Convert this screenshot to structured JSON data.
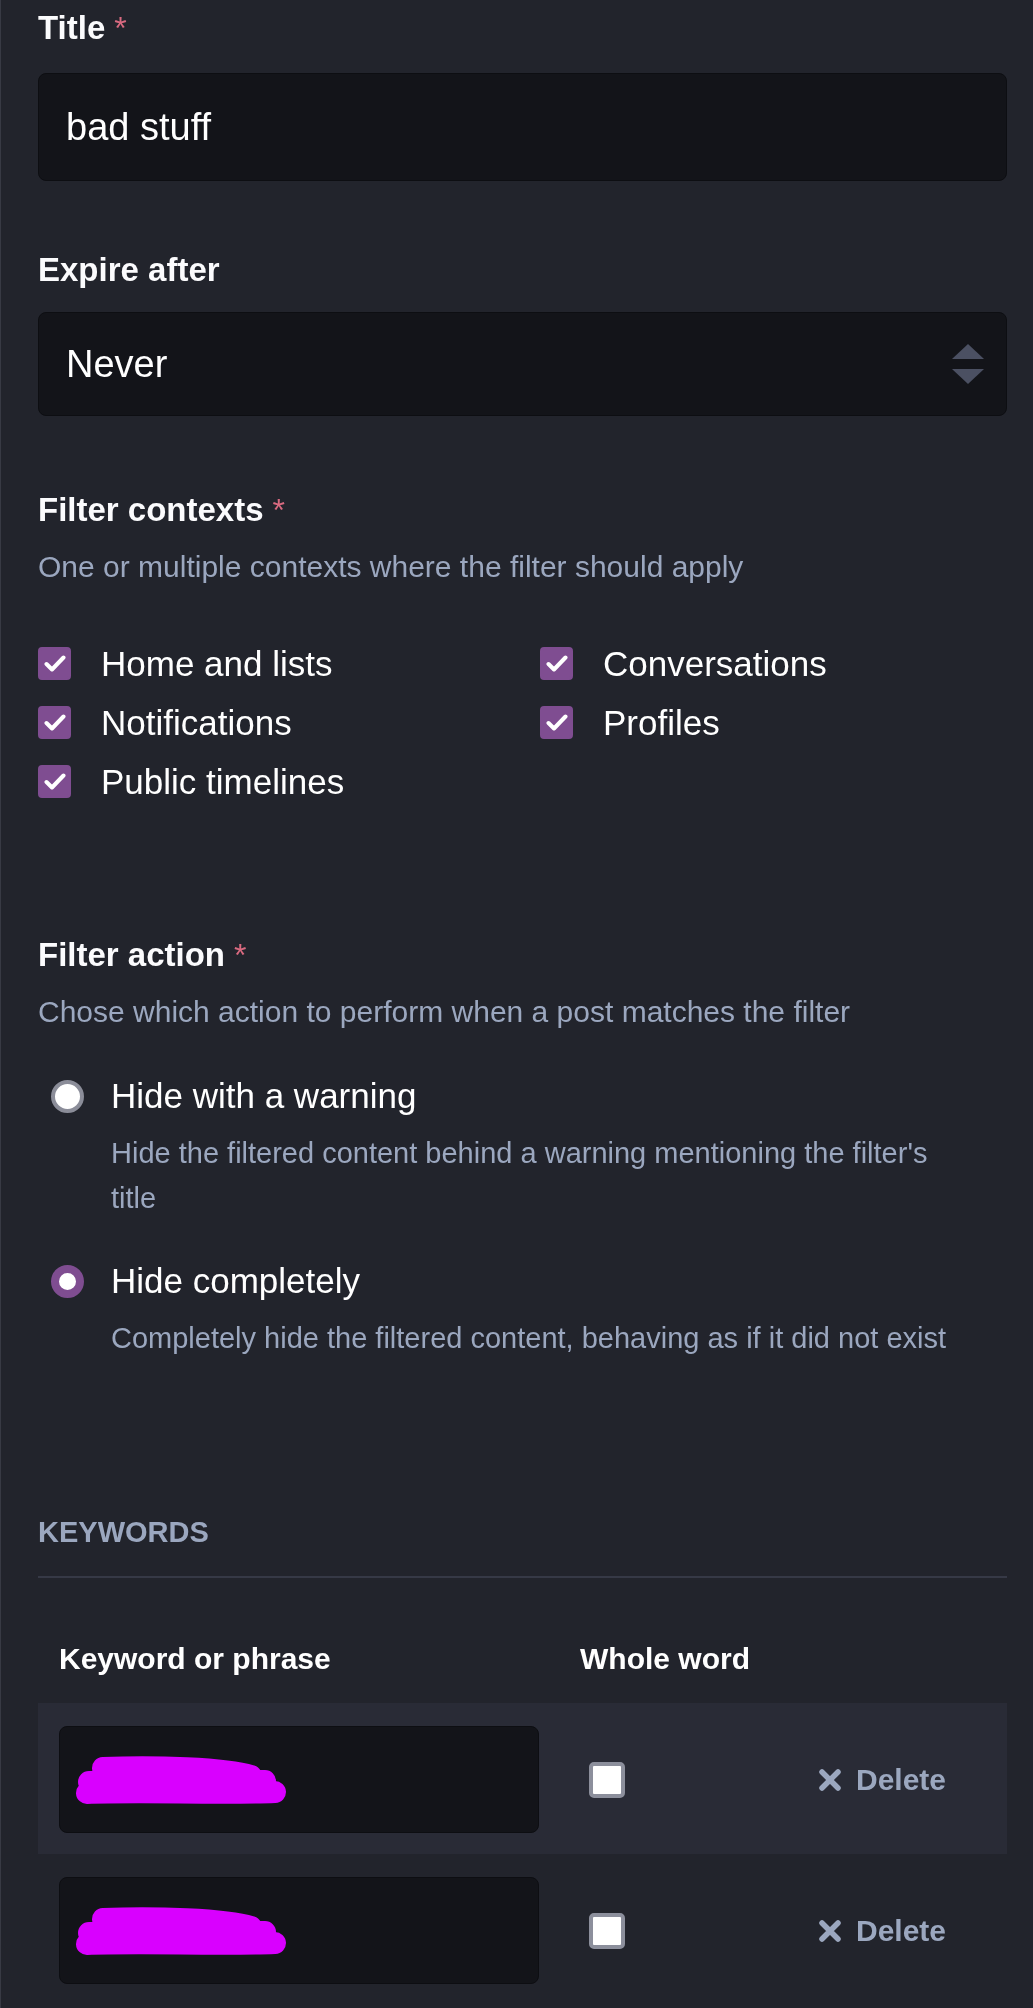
{
  "title_field": {
    "label": "Title",
    "required_mark": "*",
    "value": "bad stuff"
  },
  "expire_field": {
    "label": "Expire after",
    "value": "Never"
  },
  "filter_contexts": {
    "label": "Filter contexts",
    "required_mark": "*",
    "hint": "One or multiple contexts where the filter should apply",
    "options": [
      {
        "label": "Home and lists",
        "checked": true
      },
      {
        "label": "Notifications",
        "checked": true
      },
      {
        "label": "Public timelines",
        "checked": true
      },
      {
        "label": "Conversations",
        "checked": true
      },
      {
        "label": "Profiles",
        "checked": true
      }
    ]
  },
  "filter_action": {
    "label": "Filter action",
    "required_mark": "*",
    "hint": "Chose which action to perform when a post matches the filter",
    "options": [
      {
        "label": "Hide with a warning",
        "description": "Hide the filtered content behind a warning mentioning the filter's title",
        "selected": false
      },
      {
        "label": "Hide completely",
        "description": "Completely hide the filtered content, behaving as if it did not exist",
        "selected": true
      }
    ]
  },
  "keywords": {
    "heading": "KEYWORDS",
    "columns": [
      "Keyword or phrase",
      "Whole word"
    ],
    "rows": [
      {
        "redacted": true,
        "whole_word": false,
        "delete_label": "Delete"
      },
      {
        "redacted": true,
        "whole_word": false,
        "delete_label": "Delete"
      }
    ]
  }
}
